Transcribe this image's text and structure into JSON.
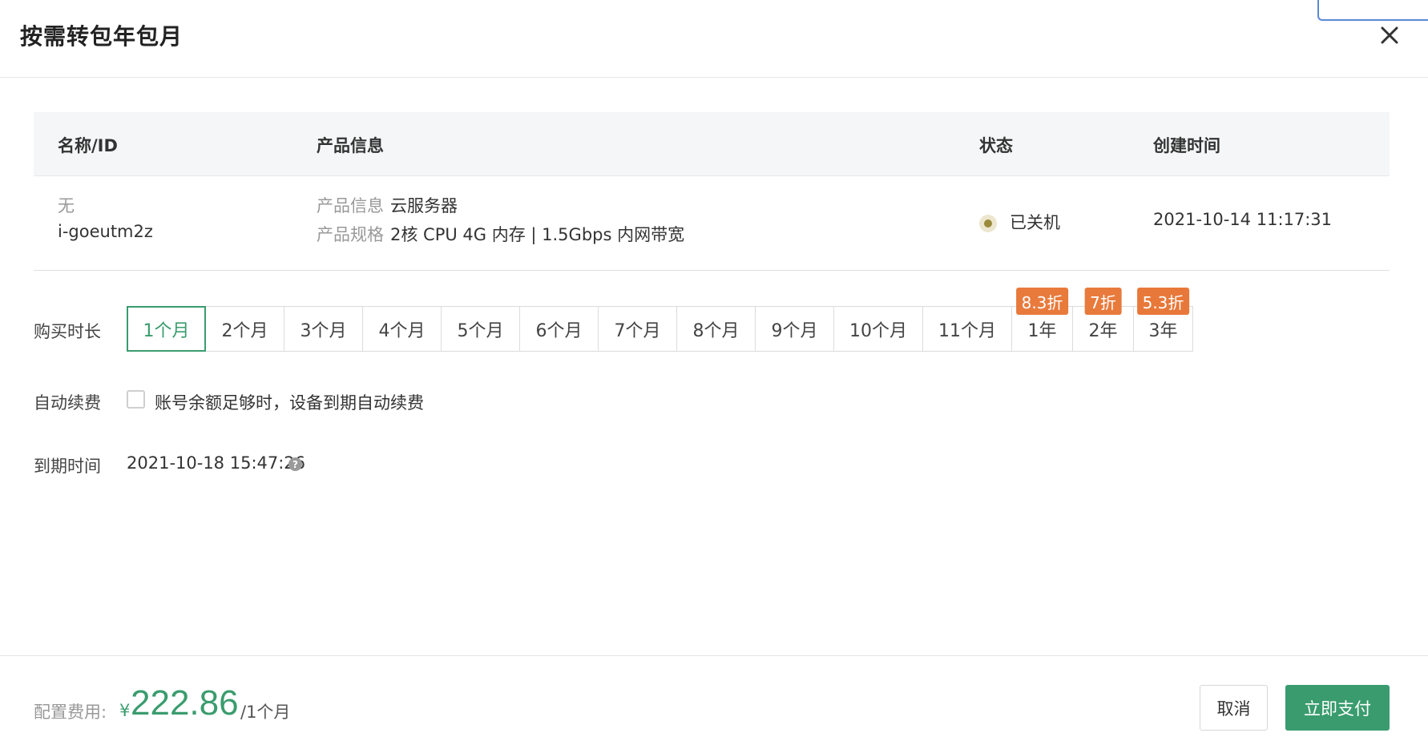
{
  "dialog": {
    "title": "按需转包年包月"
  },
  "table": {
    "headers": [
      "名称/ID",
      "产品信息",
      "状态",
      "创建时间"
    ],
    "row": {
      "name": "无",
      "id": "i-goeutm2z",
      "product_info_label": "产品信息",
      "product_info_value": "云服务器",
      "product_spec_label": "产品规格",
      "product_spec_value": "2核 CPU 4G 内存 | 1.5Gbps 内网带宽",
      "status": "已关机",
      "created_at": "2021-10-14 11:17:31"
    }
  },
  "purchase": {
    "label": "购买时长",
    "selected_option": "1个月",
    "options": [
      {
        "label": "1个月"
      },
      {
        "label": "2个月"
      },
      {
        "label": "3个月"
      },
      {
        "label": "4个月"
      },
      {
        "label": "5个月"
      },
      {
        "label": "6个月"
      },
      {
        "label": "7个月"
      },
      {
        "label": "8个月"
      },
      {
        "label": "9个月"
      },
      {
        "label": "10个月"
      },
      {
        "label": "11个月"
      },
      {
        "label": "1年",
        "badge": "8.3折"
      },
      {
        "label": "2年",
        "badge": "7折"
      },
      {
        "label": "3年",
        "badge": "5.3折"
      }
    ]
  },
  "auto_renew": {
    "label": "自动续费",
    "checked": false,
    "text": "账号余额足够时，设备到期自动续费"
  },
  "expiry": {
    "label": "到期时间",
    "value": "2021-10-18 15:47:26",
    "help_icon": "question-circle-icon"
  },
  "footer": {
    "fee_label": "配置费用:",
    "currency": "¥",
    "amount": "222.86",
    "unit": "/1个月",
    "cancel_label": "取消",
    "pay_label": "立即支付"
  },
  "colors": {
    "accent": "#3a9c6e",
    "badge": "#e87a3c",
    "status_dot": "#9a8a3a"
  }
}
